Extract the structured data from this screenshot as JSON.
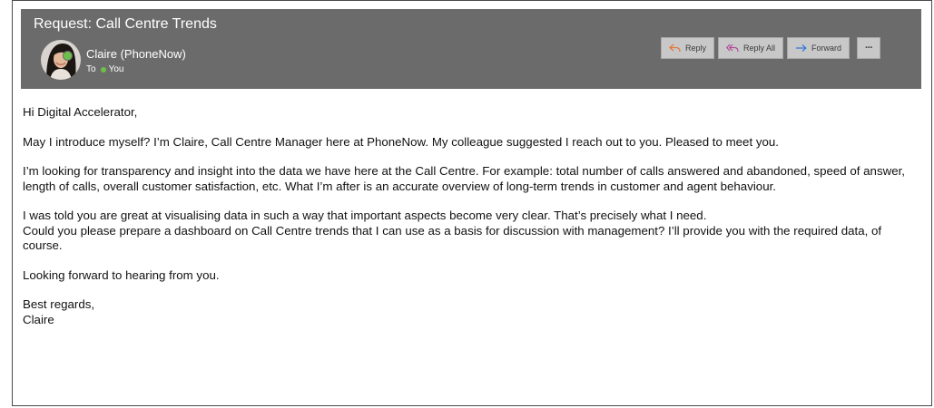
{
  "email": {
    "subject": "Request: Call Centre Trends",
    "sender": {
      "name": "Claire (PhoneNow)",
      "to_label": "To",
      "recipient": "You",
      "presence_color": "#6cc04a"
    },
    "actions": {
      "reply": {
        "label": "Reply",
        "icon": "reply-arrow-icon"
      },
      "reply_all": {
        "label": "Reply All",
        "icon": "reply-all-arrow-icon"
      },
      "forward": {
        "label": "Forward",
        "icon": "forward-arrow-icon"
      },
      "more": {
        "label": "···",
        "icon": "more-options-icon"
      }
    },
    "body": {
      "greeting": "Hi Digital Accelerator,",
      "paragraph_1": "May I introduce myself? I’m Claire, Call Centre Manager here at PhoneNow. My colleague suggested I reach out to you. Pleased to meet you.",
      "paragraph_2": "I’m looking for transparency and insight into the data we have here at the Call Centre. For example: total number of calls answered and abandoned, speed of answer, length of calls, overall customer satisfaction, etc. What I’m after is an accurate overview of long-term trends in customer and agent behaviour.",
      "paragraph_3_line_1": "I was told you are great at visualising data in such a way that important aspects become very clear. That’s precisely what I need.",
      "paragraph_3_line_2": "Could you please prepare a dashboard on Call Centre trends that I can use as a basis for discussion with management? I’ll provide you with the required data, of course.",
      "closing": "Looking forward to hearing from you.",
      "sign_off": "Best regards,",
      "signature": "Claire"
    }
  },
  "colors": {
    "header_bg": "#6b6b6b",
    "button_bg": "#c8c8c8",
    "reply_icon": "#e07a3c",
    "reply_all_icon": "#b04a9a",
    "forward_icon": "#3a7bd5"
  }
}
